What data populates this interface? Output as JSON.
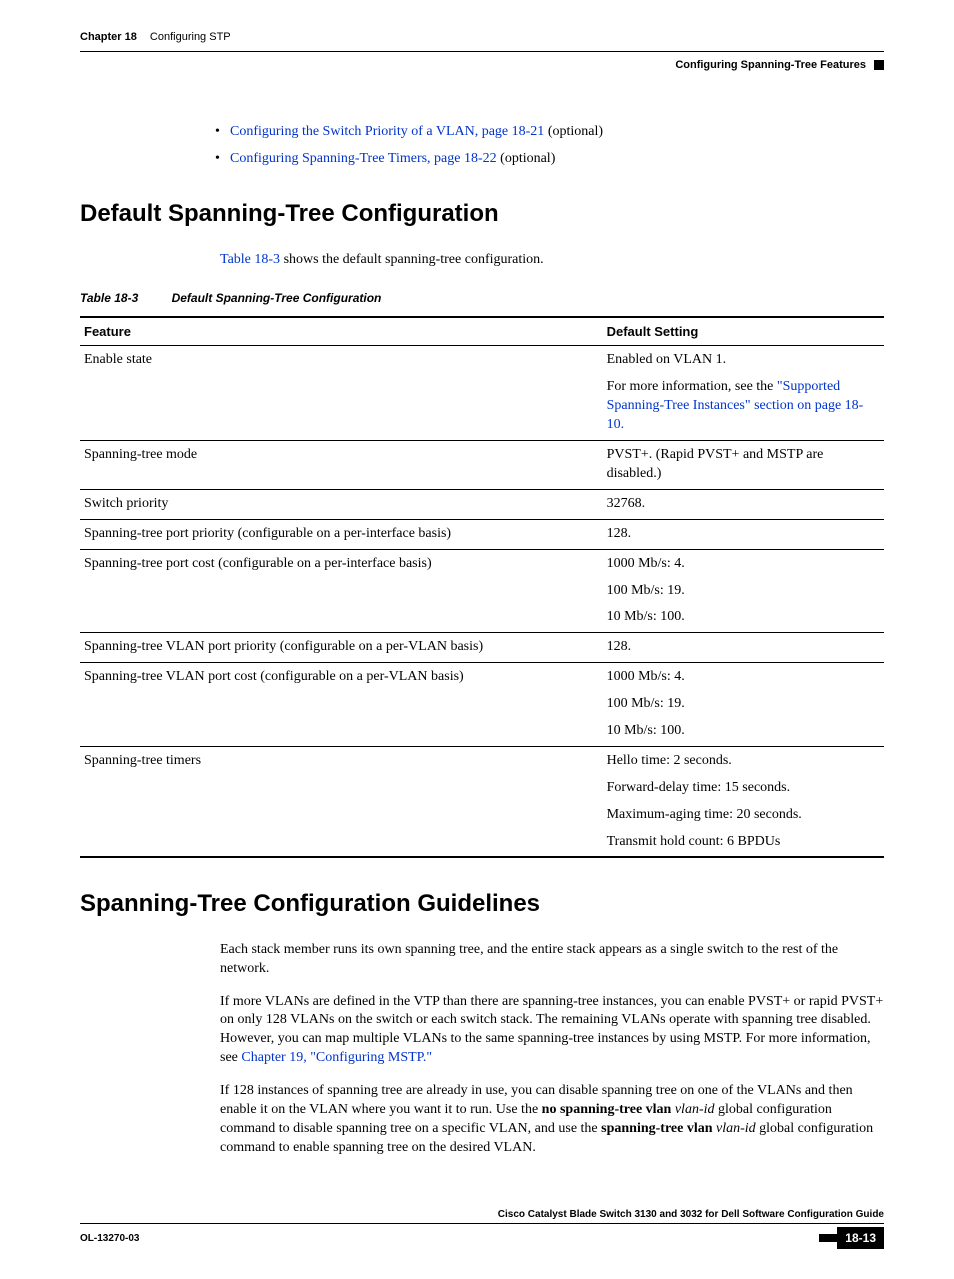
{
  "header": {
    "chapter": "Chapter 18",
    "topic": "Configuring STP",
    "subtopic": "Configuring Spanning-Tree Features"
  },
  "bullets": [
    {
      "link": "Configuring the Switch Priority of a VLAN, page 18-21",
      "suffix": " (optional)"
    },
    {
      "link": "Configuring Spanning-Tree Timers, page 18-22",
      "suffix": " (optional)"
    }
  ],
  "section1": {
    "title": "Default Spanning-Tree Configuration",
    "intro_link": "Table 18-3",
    "intro_rest": " shows the default spanning-tree configuration.",
    "table_caption_id": "Table 18-3",
    "table_caption_text": "Default Spanning-Tree Configuration",
    "col1": "Feature",
    "col2": "Default Setting"
  },
  "chart_data": {
    "type": "table",
    "columns": [
      "Feature",
      "Default Setting"
    ],
    "rows": [
      {
        "feature": "Enable state",
        "setting": "Enabled on VLAN 1.",
        "extra_prefix": "For more information, see the ",
        "extra_link": "\"Supported Spanning-Tree Instances\" section on page 18-10.",
        "extra_suffix": ""
      },
      {
        "feature": "Spanning-tree mode",
        "setting": "PVST+. (Rapid PVST+ and MSTP are disabled.)"
      },
      {
        "feature": "Switch priority",
        "setting": "32768."
      },
      {
        "feature": "Spanning-tree port priority (configurable on a per-interface basis)",
        "setting": "128."
      },
      {
        "feature": "Spanning-tree port cost (configurable on a per-interface basis)",
        "setting": "1000 Mb/s: 4.",
        "lines": [
          "100 Mb/s: 19.",
          "10 Mb/s: 100."
        ]
      },
      {
        "feature": "Spanning-tree VLAN port priority (configurable on a per-VLAN basis)",
        "setting": "128."
      },
      {
        "feature": "Spanning-tree VLAN port cost (configurable on a per-VLAN basis)",
        "setting": "1000 Mb/s: 4.",
        "lines": [
          "100 Mb/s: 19.",
          "10 Mb/s: 100."
        ]
      },
      {
        "feature": "Spanning-tree timers",
        "setting": "Hello time: 2 seconds.",
        "lines": [
          "Forward-delay time: 15 seconds.",
          "Maximum-aging time: 20 seconds.",
          "Transmit hold count: 6 BPDUs"
        ]
      }
    ]
  },
  "section2": {
    "title": "Spanning-Tree Configuration Guidelines",
    "p1": "Each stack member runs its own spanning tree, and the entire stack appears as a single switch to the rest of the network.",
    "p2a": "If more VLANs are defined in the VTP than there are spanning-tree instances, you can enable PVST+ or rapid PVST+ on only 128 VLANs on the switch or each switch stack. The remaining VLANs operate with spanning tree disabled. However, you can map multiple VLANs to the same spanning-tree instances by using MSTP. For more information, see ",
    "p2link": "Chapter 19, \"Configuring MSTP.\"",
    "p3a": "If 128 instances of spanning tree are already in use, you can disable spanning tree on one of the VLANs and then enable it on the VLAN where you want it to run. Use the ",
    "p3b1": "no spanning-tree vlan",
    "p3i1": " vlan-id ",
    "p3c": "global configuration command to disable spanning tree on a specific VLAN, and use the ",
    "p3b2": "spanning-tree vlan",
    "p3i2": " vlan-id ",
    "p3d": "global configuration command to enable spanning tree on the desired VLAN."
  },
  "footer": {
    "guide": "Cisco Catalyst Blade Switch 3130 and 3032 for Dell Software Configuration Guide",
    "docid": "OL-13270-03",
    "page": "18-13"
  }
}
